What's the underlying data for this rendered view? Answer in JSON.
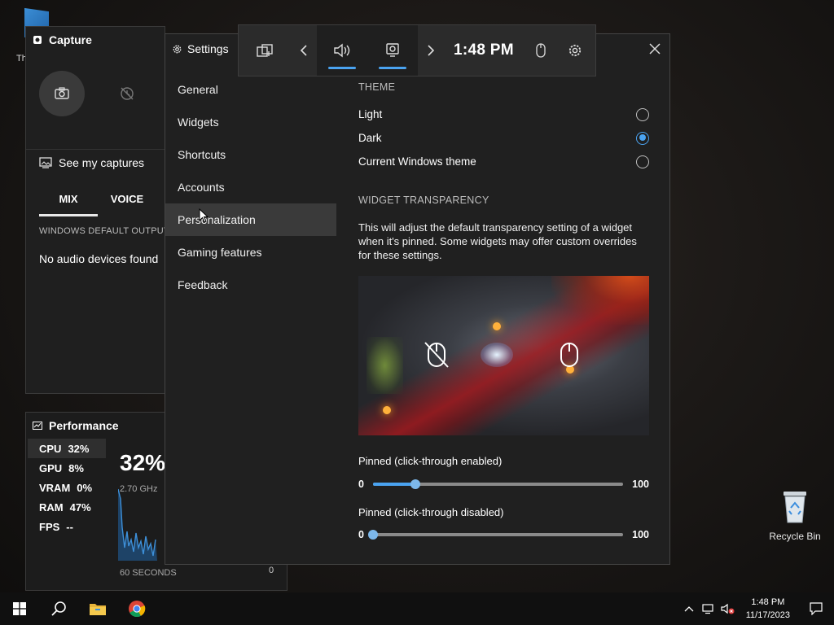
{
  "desktop": {
    "top_icon_label": "Th",
    "recycle_bin_label": "Recycle Bin"
  },
  "capture": {
    "title": "Capture",
    "see_captures": "See my captures"
  },
  "audio": {
    "tabs": [
      "MIX",
      "VOICE"
    ],
    "section": "WINDOWS DEFAULT OUTPUT",
    "empty_message": "No audio devices found"
  },
  "performance": {
    "title": "Performance",
    "stats": [
      {
        "label": "CPU",
        "value": "32%"
      },
      {
        "label": "GPU",
        "value": "8%"
      },
      {
        "label": "VRAM",
        "value": "0%"
      },
      {
        "label": "RAM",
        "value": "47%"
      },
      {
        "label": "FPS",
        "value": "--"
      }
    ],
    "big_value": "32%",
    "frequency": "2.70 GHz",
    "duration": "60 SECONDS",
    "axis_min": "0"
  },
  "gamebar": {
    "time": "1:48 PM"
  },
  "settings": {
    "title": "Settings",
    "nav": [
      "General",
      "Widgets",
      "Shortcuts",
      "Accounts",
      "Personalization",
      "Gaming features",
      "Feedback"
    ],
    "selected_nav": "Personalization",
    "theme": {
      "heading": "THEME",
      "options": [
        {
          "label": "Light",
          "selected": false
        },
        {
          "label": "Dark",
          "selected": true
        },
        {
          "label": "Current Windows theme",
          "selected": false
        }
      ]
    },
    "transparency": {
      "heading": "WIDGET TRANSPARENCY",
      "description": "This will adjust the default transparency setting of a widget when it's pinned. Some widgets may offer custom overrides for these settings.",
      "sliders": [
        {
          "label": "Pinned (click-through enabled)",
          "min": "0",
          "max": "100",
          "value": 17
        },
        {
          "label": "Pinned (click-through disabled)",
          "min": "0",
          "max": "100",
          "value": 0
        }
      ]
    }
  },
  "taskbar": {
    "clock_time": "1:48 PM",
    "clock_date": "11/17/2023"
  },
  "colors": {
    "accent": "#4aa3f0",
    "panel": "#202020",
    "selected_nav": "#3a3a3a"
  }
}
